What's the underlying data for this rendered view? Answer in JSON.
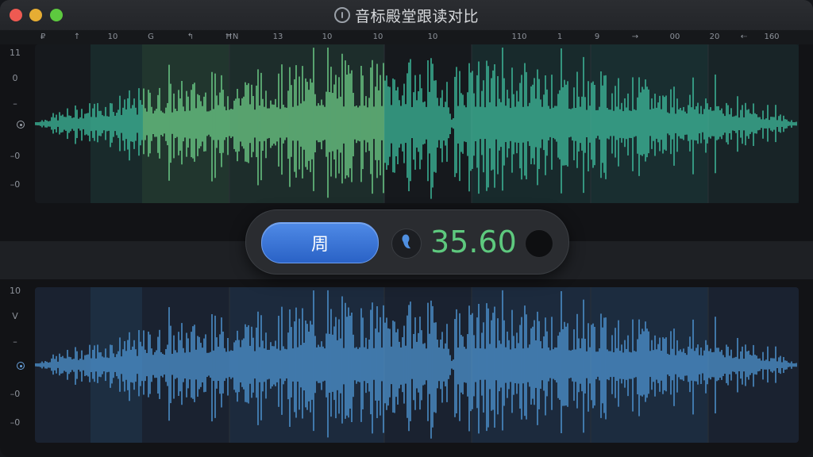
{
  "window": {
    "title": "音标殿堂跟读对比",
    "title_icon": "app-logo-icon"
  },
  "ruler": {
    "labels": [
      "₽",
      "↑",
      "10",
      "G",
      "↰",
      "ĦN",
      "13",
      "10",
      "10",
      "10",
      "110",
      "1",
      "9",
      "→",
      "00",
      "20",
      "⇠",
      "160"
    ]
  },
  "top_axis": {
    "labels": [
      "11",
      "0",
      "–",
      "–0",
      "–0"
    ]
  },
  "bottom_axis": {
    "labels": [
      "10",
      "V",
      "–",
      "–0",
      "–0"
    ]
  },
  "controls": {
    "play_label": "周",
    "mic_icon": "microphone-icon",
    "score": "35.60",
    "round_button_icon": "record-icon"
  },
  "colors": {
    "reference_wave": "#3fbf9f",
    "reference_highlight": "#6fd18a",
    "user_wave": "#4f97d6",
    "score": "#5ec97e",
    "play_button": "#2f6fd6"
  }
}
